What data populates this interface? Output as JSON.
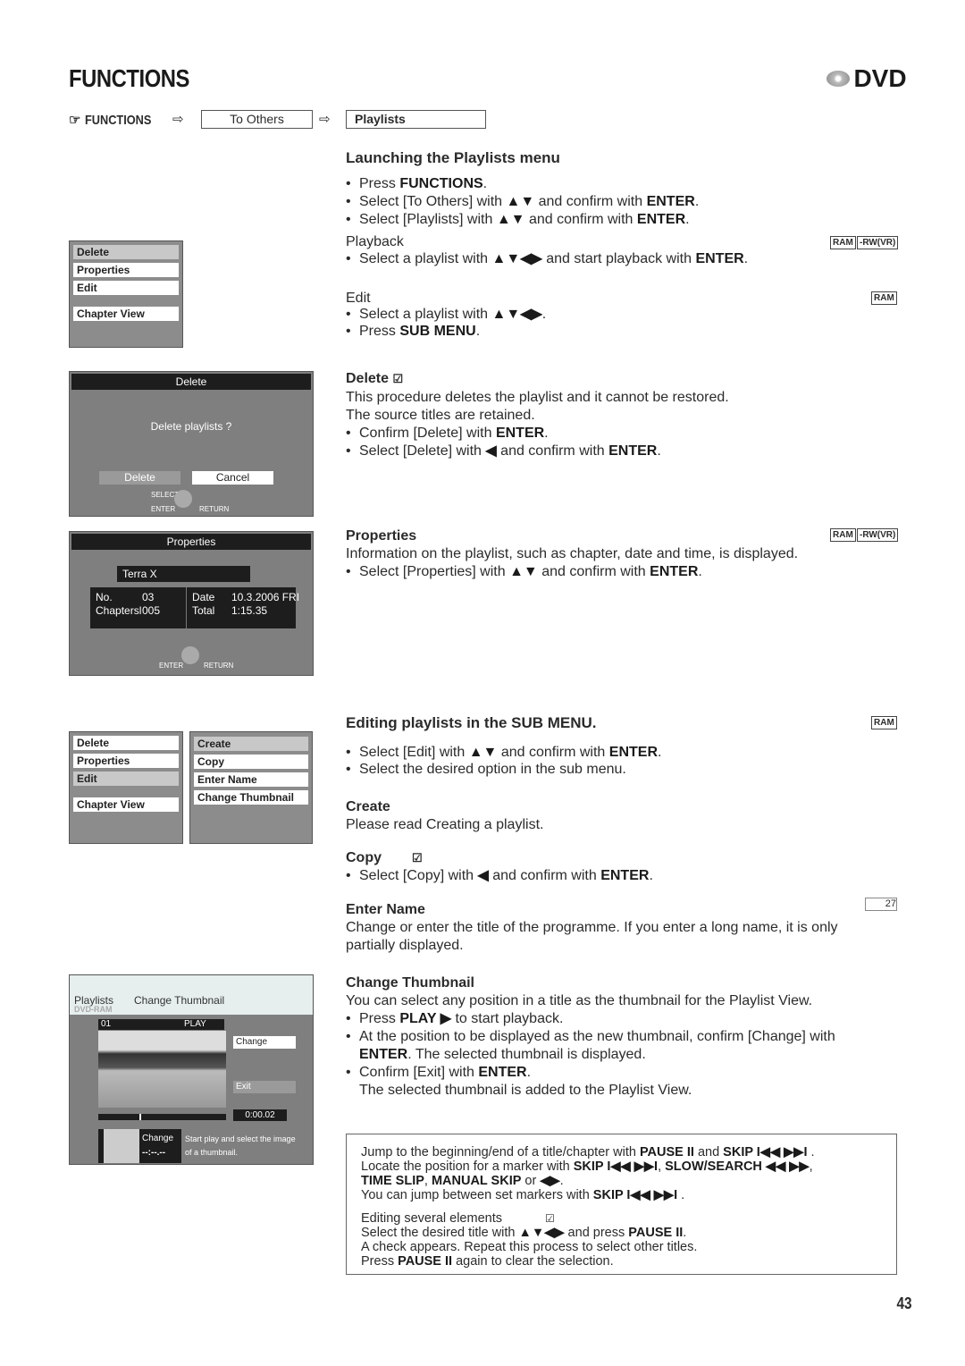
{
  "header": {
    "title": "FUNCTIONS",
    "logo": "DVD"
  },
  "nav": {
    "start": "FUNCTIONS",
    "step1": "To Others",
    "step2": "Playlists"
  },
  "launch": {
    "heading": "Launching the Playlists menu",
    "lines": [
      [
        "Press ",
        {
          "b": "FUNCTIONS"
        },
        "."
      ],
      [
        "Select [To Others] with ",
        {
          "b": "▲▼"
        },
        " and confirm with ",
        {
          "b": "ENTER"
        },
        "."
      ],
      [
        "Select [Playlists] with ",
        {
          "b": "▲▼"
        },
        " and confirm with ",
        {
          "b": "ENTER"
        },
        "."
      ]
    ]
  },
  "playback": {
    "label": "Playback",
    "lines": [
      [
        "Select a playlist with ",
        {
          "b": "▲▼◀▶"
        },
        " and start playback with ",
        {
          "b": "ENTER"
        },
        "."
      ]
    ],
    "badges": [
      "RAM",
      "-RW(VR)"
    ]
  },
  "edit": {
    "label": "Edit",
    "lines": [
      [
        "Select a playlist with ",
        {
          "b": "▲▼◀▶"
        },
        "."
      ],
      [
        "Press ",
        {
          "b": "SUB MENU"
        },
        "."
      ]
    ],
    "badges": [
      "RAM"
    ]
  },
  "delete": {
    "heading": "Delete",
    "lines": [
      [
        "This procedure deletes the playlist and it cannot be restored."
      ],
      [
        "The source titles are retained."
      ],
      [
        "Confirm [Delete] with ",
        {
          "b": "ENTER"
        },
        "."
      ],
      [
        "Select [Delete] with ",
        {
          "b": "◀"
        },
        " and confirm with ",
        {
          "b": "ENTER"
        },
        "."
      ]
    ]
  },
  "properties": {
    "heading": "Properties",
    "badges": [
      "RAM",
      "-RW(VR)"
    ],
    "lines": [
      [
        "Information on the playlist, such as chapter, date and time, is displayed."
      ],
      [
        "Select [Properties] with ",
        {
          "b": "▲▼"
        },
        " and confirm with ",
        {
          "b": "ENTER"
        },
        "."
      ]
    ]
  },
  "submenu": {
    "heading": "Editing playlists in the SUB MENU.",
    "badges": [
      "RAM"
    ],
    "lines": [
      [
        "Select [Edit] with ",
        {
          "b": "▲▼"
        },
        " and confirm with ",
        {
          "b": "ENTER"
        },
        "."
      ],
      [
        "Select the desired option in the sub menu."
      ]
    ]
  },
  "create": {
    "heading": "Create",
    "lines": [
      [
        "Please read Creating a playlist."
      ]
    ]
  },
  "copy": {
    "heading": "Copy",
    "lines": [
      [
        "Select [Copy] with ",
        {
          "b": "◀"
        },
        " and confirm with ",
        {
          "b": "ENTER"
        },
        "."
      ]
    ]
  },
  "enter_name": {
    "heading": "Enter Name",
    "page_ref": "27",
    "lines": [
      [
        "Change or enter the title of the programme. If you enter a long name, it is only"
      ],
      [
        "partially displayed."
      ]
    ]
  },
  "change_thumb": {
    "heading": "Change Thumbnail",
    "lines": [
      [
        "You can select any position in a title as the thumbnail for the Playlist View."
      ],
      [
        "Press ",
        {
          "b": "PLAY ▶"
        },
        " to start playback."
      ],
      [
        "At the position to be displayed as the new thumbnail, confirm [Change] with"
      ],
      [
        {
          "b": "ENTER"
        },
        ". The selected thumbnail is displayed."
      ],
      [
        "Confirm [Exit] with ",
        {
          "b": "ENTER"
        },
        "."
      ],
      [
        "The selected thumbnail is added to the Playlist View."
      ]
    ]
  },
  "note": {
    "lines": [
      [
        "Jump to the beginning/end of a title/chapter with ",
        {
          "b": "PAUSE II"
        },
        " and ",
        {
          "b": "SKIP I◀◀ ▶▶I"
        },
        " ."
      ],
      [
        "Locate the position for a marker with ",
        {
          "b": "SKIP I◀◀ ▶▶I"
        },
        ", ",
        {
          "b": "SLOW/SEARCH ◀◀ ▶▶"
        },
        ","
      ],
      [
        {
          "b": "TIME SLIP"
        },
        ", ",
        {
          "b": "MANUAL SKIP"
        },
        " or ",
        {
          "b": "◀▶"
        },
        "."
      ],
      [
        "You can jump between set markers with ",
        {
          "b": "SKIP I◀◀ ▶▶I"
        },
        " ."
      ],
      [
        "Editing several elements"
      ],
      [
        "Select the desired title with ",
        {
          "b": "▲▼◀▶"
        },
        " and press ",
        {
          "b": "PAUSE II"
        },
        "."
      ],
      [
        "A check appears. Repeat this process to select other titles."
      ],
      [
        "Press ",
        {
          "b": "PAUSE II"
        },
        " again to clear the selection."
      ]
    ]
  },
  "screens": {
    "menu": [
      "Delete",
      "Properties",
      "Edit",
      "Chapter View"
    ],
    "submenu": [
      "Create",
      "Copy",
      "Enter Name",
      "Change Thumbnail"
    ],
    "delete_dialog": {
      "title": "Delete",
      "question": "Delete playlists ?",
      "ok": "Delete",
      "cancel": "Cancel",
      "select": "SELECT",
      "enter": "ENTER",
      "return": "RETURN"
    },
    "props_dialog": {
      "title": "Properties",
      "name": "Terra X",
      "no_label": "No.",
      "no": "03",
      "chapters_label": "Chaptersl",
      "chapters": "005",
      "date_label": "Date",
      "date": "10.3.2006 FRI",
      "total_label": "Total",
      "total": "1:15.35",
      "enter": "ENTER",
      "return": "RETURN"
    },
    "thumb": {
      "crumb": "Playlists",
      "title": "Change Thumbnail",
      "disc": "DVD-RAM",
      "num": "01",
      "status": "PLAY",
      "change": "Change",
      "exit": "Exit",
      "time": "0:00.02",
      "thumb_label": "Change",
      "thumb_time": "--:--.--",
      "hint1": "Start play and select the image",
      "hint2": "of a thumbnail."
    }
  },
  "page_number": "43"
}
